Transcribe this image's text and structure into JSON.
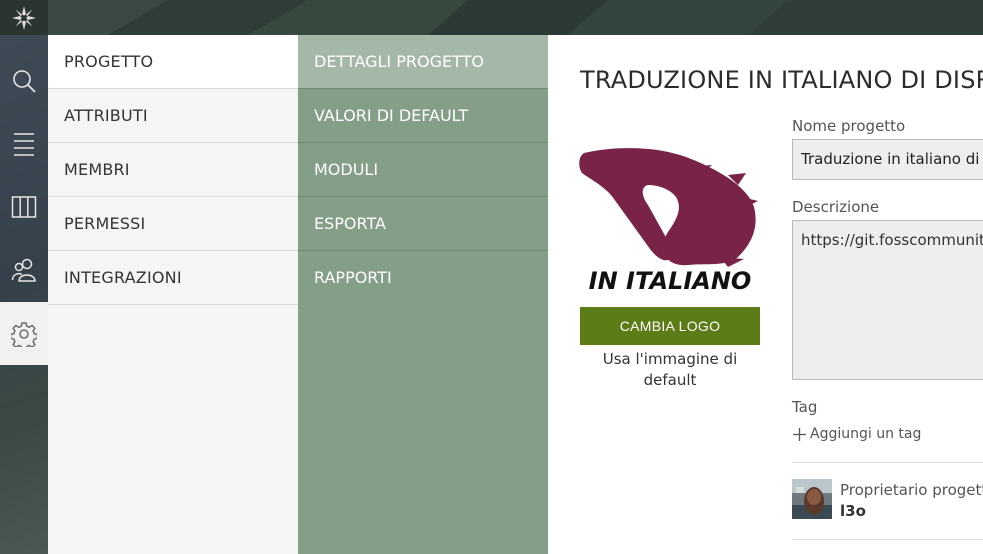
{
  "colors": {
    "accent_green": "#5b7c16",
    "submenu_green": "#849e87",
    "submenu_active": "#a5b8a7",
    "logo_maroon": "#7a2348"
  },
  "topbar": {
    "brand_icon": "taiga-logo-icon"
  },
  "rail": {
    "items": [
      {
        "icon": "search-icon"
      },
      {
        "icon": "backlog-list-icon"
      },
      {
        "icon": "kanban-board-icon"
      },
      {
        "icon": "team-icon"
      },
      {
        "icon": "settings-gear-icon",
        "active": true
      }
    ]
  },
  "menu1": {
    "items": [
      {
        "label": "Progetto",
        "active": true
      },
      {
        "label": "Attributi"
      },
      {
        "label": "Membri"
      },
      {
        "label": "Permessi"
      },
      {
        "label": "Integrazioni"
      }
    ]
  },
  "menu2": {
    "items": [
      {
        "label": "Dettagli progetto",
        "active": true
      },
      {
        "label": "Valori di default"
      },
      {
        "label": "Moduli"
      },
      {
        "label": "Esporta"
      },
      {
        "label": "Rapporti"
      }
    ]
  },
  "main": {
    "title": "TRADUZIONE IN ITALIANO DI DISROOT",
    "logo_text": "IN ITALIANO",
    "change_logo_label": "Cambia logo",
    "default_image_label": "Usa l'immagine di default",
    "name_label": "Nome progetto",
    "name_value": "Traduzione in italiano di Disroot",
    "description_label": "Descrizione",
    "description_value": "https://git.fosscommunity.in",
    "tag_label": "Tag",
    "add_tag_label": "Aggiungi un tag",
    "owner_label": "Proprietario progetto",
    "owner_name": "l3o"
  }
}
